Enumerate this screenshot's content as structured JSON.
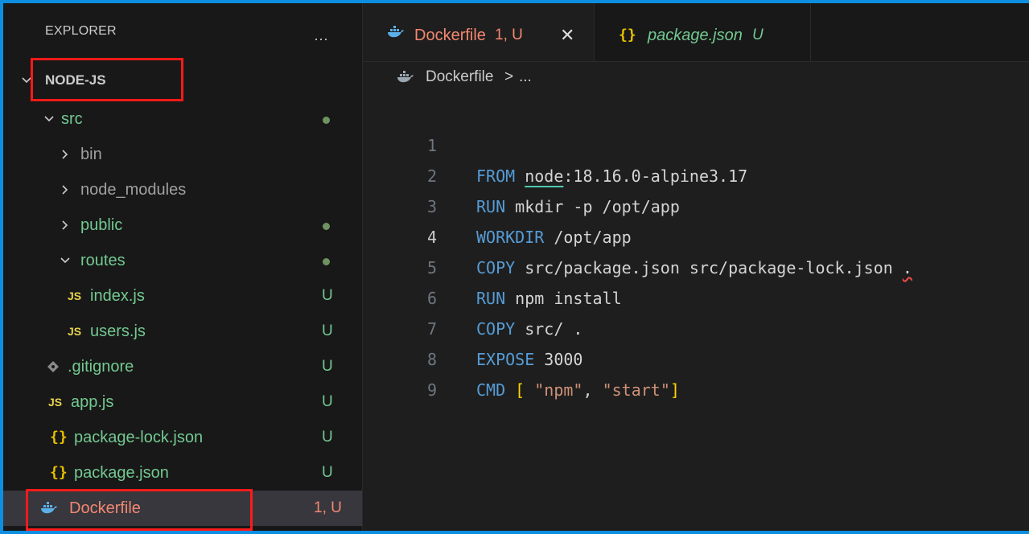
{
  "explorer": {
    "title": "EXPLORER",
    "more": "···",
    "root": "NODE-JS",
    "items": [
      {
        "label": "src",
        "status": ""
      },
      {
        "label": "bin",
        "status": ""
      },
      {
        "label": "node_modules",
        "status": ""
      },
      {
        "label": "public",
        "status": ""
      },
      {
        "label": "routes",
        "status": ""
      },
      {
        "label": "index.js",
        "status": "U",
        "icon": "JS"
      },
      {
        "label": "users.js",
        "status": "U",
        "icon": "JS"
      },
      {
        "label": ".gitignore",
        "status": "U"
      },
      {
        "label": "app.js",
        "status": "U",
        "icon": "JS"
      },
      {
        "label": "package-lock.json",
        "status": "U",
        "icon": "{}"
      },
      {
        "label": "package.json",
        "status": "U",
        "icon": "{}"
      },
      {
        "label": "Dockerfile",
        "status": "1, U"
      }
    ]
  },
  "tabs": [
    {
      "label": "Dockerfile",
      "status": "1, U",
      "close": "✕"
    },
    {
      "label": "package.json",
      "status": "U",
      "icon": "{}"
    }
  ],
  "breadcrumb": {
    "file": "Dockerfile",
    "sep": ">",
    "rest": "..."
  },
  "code": {
    "line_numbers": [
      "1",
      "2",
      "3",
      "4",
      "5",
      "6",
      "7",
      "8",
      "9"
    ],
    "lines": [
      {
        "kw": "FROM",
        "a": "node",
        "b": ":18.16.0-alpine3.17"
      },
      {
        "kw": "RUN",
        "a": "mkdir -p /opt/app"
      },
      {
        "kw": "WORKDIR",
        "a": "/opt/app"
      },
      {
        "kw": "COPY",
        "a": "src/package.json src/package-lock.json",
        "b": "."
      },
      {
        "kw": "RUN",
        "a": "npm install"
      },
      {
        "kw": "COPY",
        "a": "src/ ."
      },
      {
        "kw": "EXPOSE",
        "a": "3000"
      },
      {
        "kw": "CMD",
        "lb": "[",
        "s1": "\"npm\"",
        "comma": ", ",
        "s2": "\"start\"",
        "rb": "]"
      }
    ]
  },
  "colors": {
    "window_border": "#0e8ee0",
    "annotation": "#ff1a1a",
    "untracked_green": "#73c991",
    "error_red": "#f48771"
  }
}
